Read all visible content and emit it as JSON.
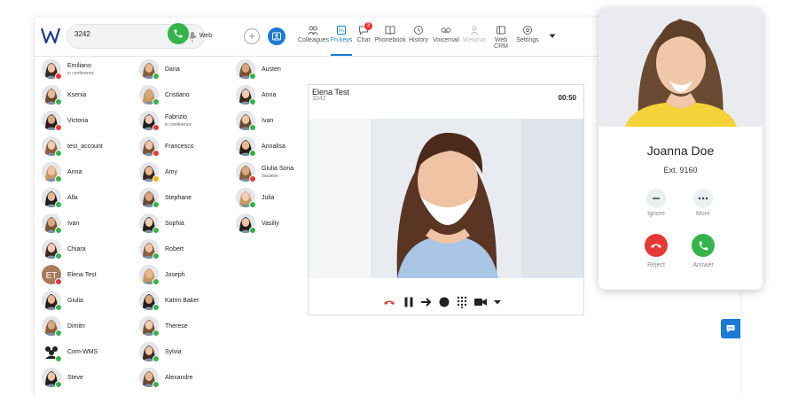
{
  "toolbar": {
    "dial_value": "3242",
    "web_label": "Web",
    "nav": [
      {
        "label": "Colleagues",
        "icon": "colleagues-icon"
      },
      {
        "label": "Fn keys",
        "icon": "fnkeys-icon",
        "active": true
      },
      {
        "label": "Chat",
        "icon": "chat-icon",
        "badge": "3"
      },
      {
        "label": "Phonebook",
        "icon": "phonebook-icon"
      },
      {
        "label": "History",
        "icon": "history-icon"
      },
      {
        "label": "Voicemail",
        "icon": "voicemail-icon"
      },
      {
        "label": "Webinar",
        "icon": "webinar-icon",
        "disabled": true
      },
      {
        "label": "Web CRM",
        "icon": "webcrm-icon"
      },
      {
        "label": "Settings",
        "icon": "settings-icon"
      }
    ]
  },
  "contacts": {
    "col1": [
      {
        "name": "Emiliano",
        "sub": "in conference",
        "status": "#e53935"
      },
      {
        "name": "Ksenia",
        "status": "#34b44a"
      },
      {
        "name": "Victoria",
        "status": "#e53935"
      },
      {
        "name": "test_account",
        "status": "#34b44a"
      },
      {
        "name": "Anna",
        "status": "#34b44a"
      },
      {
        "name": "Alla",
        "status": "#34b44a"
      },
      {
        "name": "Ivan",
        "status": "#34b44a"
      },
      {
        "name": "Chiara",
        "status": "#34b44a"
      },
      {
        "name": "Elena Test",
        "status": "#e53935",
        "initials": "ET"
      },
      {
        "name": "Giulia",
        "status": "#34b44a"
      },
      {
        "name": "Dimitri",
        "status": "#34b44a"
      },
      {
        "name": "Com-WMS",
        "status": "#34b44a",
        "group": true
      },
      {
        "name": "Steve",
        "status": "#34b44a"
      }
    ],
    "col2": [
      {
        "name": "Daria",
        "status": "#34b44a"
      },
      {
        "name": "Cristiano",
        "status": "#34b44a"
      },
      {
        "name": "Fabrizio",
        "sub": "in conference",
        "status": "#e53935"
      },
      {
        "name": "Francesco",
        "status": "#e53935"
      },
      {
        "name": "Amy",
        "status": "#f2b705"
      },
      {
        "name": "Stephane",
        "status": "#34b44a"
      },
      {
        "name": "Sophia",
        "status": "#34b44a"
      },
      {
        "name": "Robert",
        "status": "#34b44a"
      },
      {
        "name": "Joseph",
        "status": "#34b44a"
      },
      {
        "name": "Katrin Baker",
        "status": "#34b44a"
      },
      {
        "name": "Therese",
        "status": "#34b44a"
      },
      {
        "name": "Sylvia",
        "status": "#34b44a"
      },
      {
        "name": "Alexandre",
        "status": "#34b44a"
      }
    ],
    "col3": [
      {
        "name": "Austen",
        "status": "#34b44a"
      },
      {
        "name": "Anna",
        "status": "#34b44a"
      },
      {
        "name": "Ivan",
        "status": "#34b44a"
      },
      {
        "name": "Annalisa",
        "status": "#34b44a"
      },
      {
        "name": "Giulia Sona",
        "sub": "Vacation",
        "status": "#e53935"
      },
      {
        "name": "Julia",
        "status": "#34b44a"
      },
      {
        "name": "Vasiliy",
        "status": "#34b44a"
      }
    ]
  },
  "video_call": {
    "name": "Elena Test",
    "ext": "3242",
    "timer": "00:50"
  },
  "incoming_call": {
    "name": "Joanna Doe",
    "ext": "Ext. 9160",
    "ignore_label": "Ignore",
    "more_label": "More",
    "reject_label": "Reject",
    "answer_label": "Answer"
  },
  "colors": {
    "accent": "#1a7bd5",
    "green": "#34b44a",
    "red": "#e53935"
  }
}
